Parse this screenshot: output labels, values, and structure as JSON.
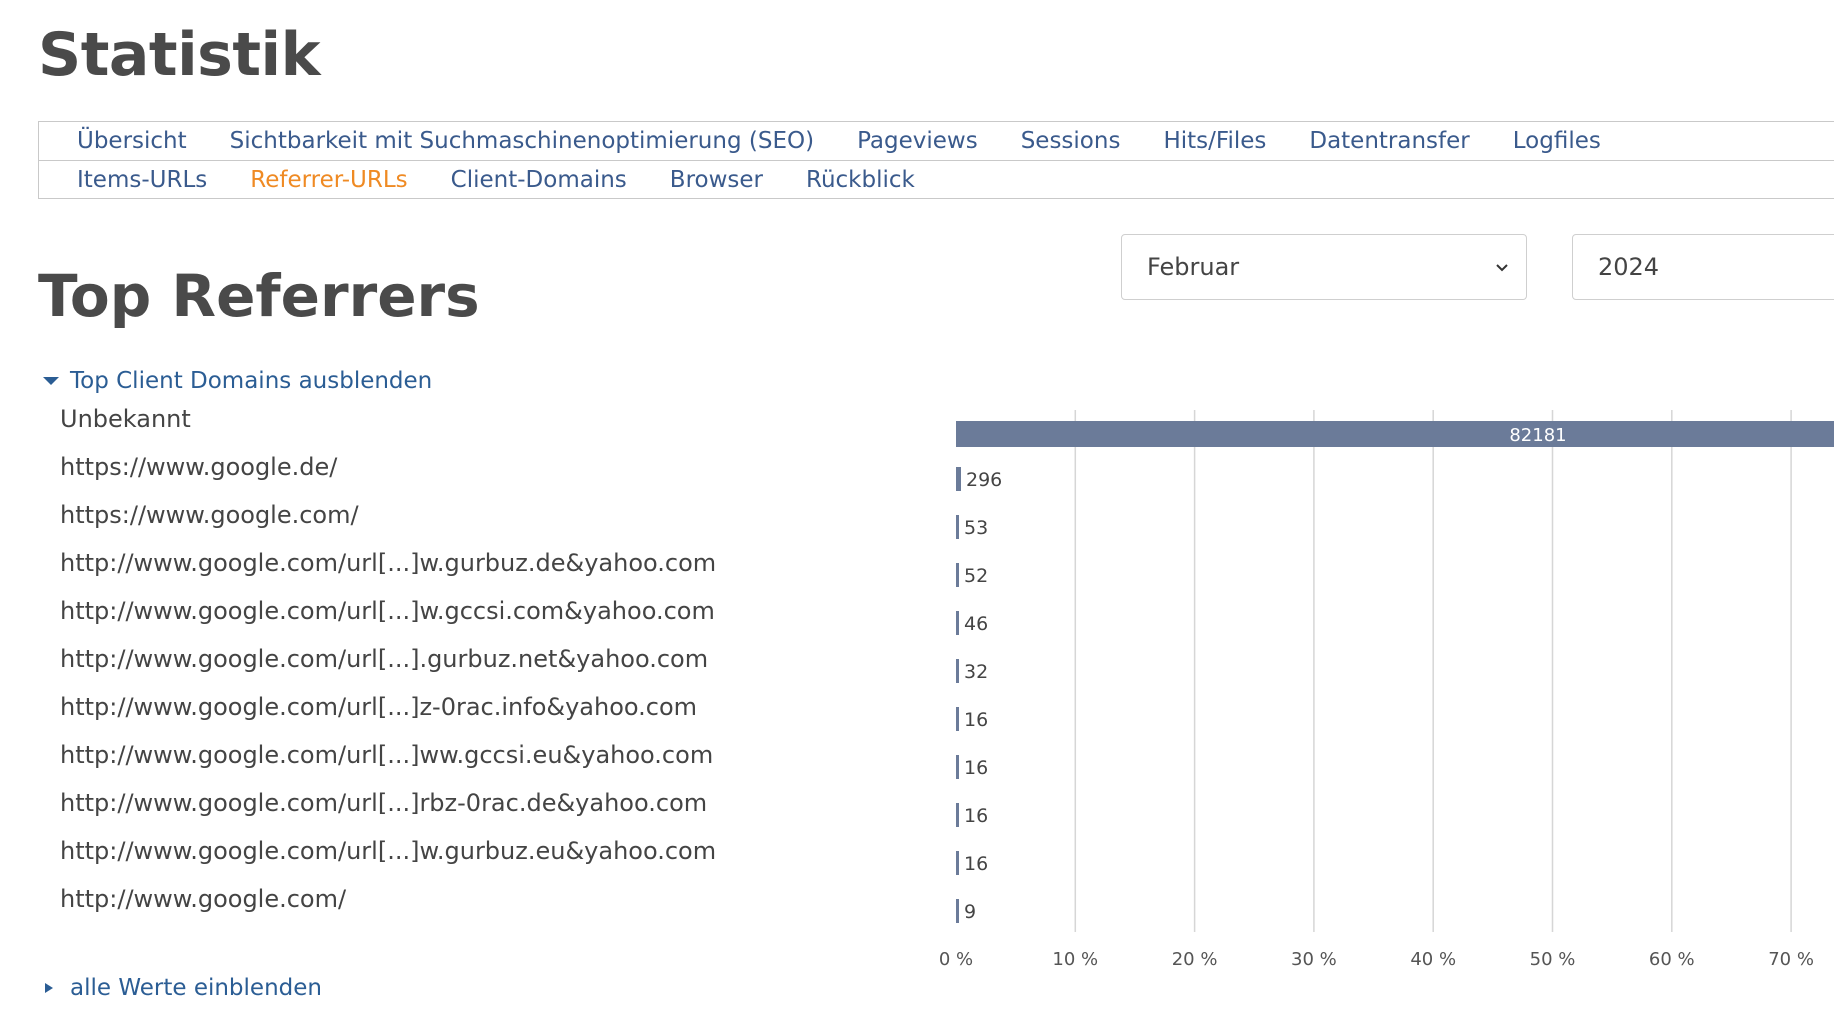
{
  "page": {
    "title": "Statistik"
  },
  "nav": {
    "row1": [
      {
        "label": "Übersicht",
        "active": false
      },
      {
        "label": "Sichtbarkeit mit Suchmaschinenoptimierung (SEO)",
        "active": false
      },
      {
        "label": "Pageviews",
        "active": false
      },
      {
        "label": "Sessions",
        "active": false
      },
      {
        "label": "Hits/Files",
        "active": false
      },
      {
        "label": "Datentransfer",
        "active": false
      },
      {
        "label": "Logfiles",
        "active": false
      }
    ],
    "row2": [
      {
        "label": "Items-URLs",
        "active": false
      },
      {
        "label": "Referrer-URLs",
        "active": true
      },
      {
        "label": "Client-Domains",
        "active": false
      },
      {
        "label": "Browser",
        "active": false
      },
      {
        "label": "Rückblick",
        "active": false
      }
    ]
  },
  "filters": {
    "month": "Februar",
    "year": "2024"
  },
  "section": {
    "title": "Top Referrers",
    "toggle_label": "Top Client Domains ausblenden",
    "show_all_label": "alle Werte einblenden"
  },
  "colors": {
    "bar": "#6b7b99",
    "grid": "#d6d6d6",
    "link": "#2b5d94",
    "active_nav": "#ef8a23"
  },
  "chart_data": {
    "type": "bar",
    "orientation": "horizontal",
    "categories": [
      "Unbekannt",
      "https://www.google.de/",
      "https://www.google.com/",
      "http://www.google.com/url[...]w.gurbuz.de&yahoo.com",
      "http://www.google.com/url[...]w.gccsi.com&yahoo.com",
      "http://www.google.com/url[...].gurbuz.net&yahoo.com",
      "http://www.google.com/url[...]z-0rac.info&yahoo.com",
      "http://www.google.com/url[...]ww.gccsi.eu&yahoo.com",
      "http://www.google.com/url[...]rbz-0rac.de&yahoo.com",
      "http://www.google.com/url[...]w.gurbuz.eu&yahoo.com",
      "http://www.google.com/"
    ],
    "values": [
      82181,
      296,
      53,
      52,
      46,
      32,
      16,
      16,
      16,
      16,
      9
    ],
    "value_labels": [
      "82181",
      "296",
      "53",
      "52",
      "46",
      "32",
      "16",
      "16",
      "16",
      "16",
      "9"
    ],
    "x_unit": "percent",
    "x_ticks": [
      0,
      10,
      20,
      30,
      40,
      50,
      60,
      70
    ],
    "x_tick_labels": [
      "0 %",
      "10 %",
      "20 %",
      "30 %",
      "40 %",
      "50 %",
      "60 %",
      "70 %"
    ],
    "full_bar_percent": 75,
    "grid": true
  }
}
